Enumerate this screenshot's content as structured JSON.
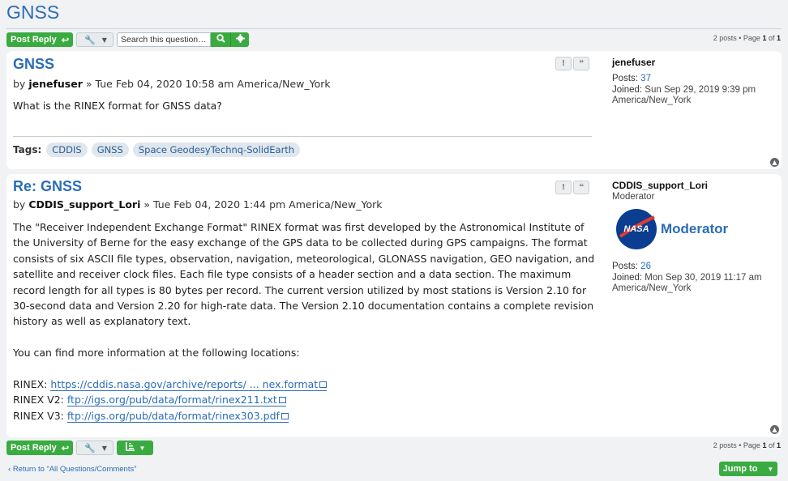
{
  "page": {
    "title": "GNSS"
  },
  "toolbar": {
    "post_reply": "Post Reply",
    "search_placeholder": "Search this question…",
    "page_info_prefix": "2 posts • Page ",
    "page_current": "1",
    "page_of": " of ",
    "page_total": "1"
  },
  "posts": [
    {
      "title": "GNSS",
      "by": "by",
      "author": "jenefuser",
      "date": "» Tue Feb 04, 2020 10:58 am America/New_York",
      "body": "What is the RINEX format for GNSS data?",
      "tags_label": "Tags:",
      "tags": [
        "CDDIS",
        "GNSS",
        "Space GeodesyTechnq-SolidEarth"
      ],
      "profile": {
        "name": "jenefuser",
        "posts_label": "Posts:",
        "posts": "37",
        "joined_label": "Joined:",
        "joined": "Sun Sep 29, 2019 9:39 pm",
        "tz": "America/New_York"
      }
    },
    {
      "title": "Re: GNSS",
      "by": "by",
      "author": "CDDIS_support_Lori",
      "date": "» Tue Feb 04, 2020 1:44 pm America/New_York",
      "paragraph1": [
        "The \"Receiver Independent Exchange Format\" RINEX format was first developed by the Astronomical Institute of",
        "the University of Berne for the easy exchange of the GPS data to be collected during GPS campaigns. The format",
        "consists of six ASCII file types, observation, navigation, meteorological, GLONASS navigation, GEO navigation, and",
        "satellite and receiver clock files. Each file type consists of a header section and a data section. The maximum",
        "record length for all types is 80 bytes per record. The current version utilized by most stations is Version 2.10 for",
        "30-second data and Version 2.20 for high-rate data. The Version 2.10 documentation contains a complete revision",
        "history as well as explanatory text."
      ],
      "paragraph2": "You can find more information at the following locations:",
      "links": [
        {
          "label": "RINEX:",
          "url": "https://cddis.nasa.gov/archive/reports/ ... nex.format"
        },
        {
          "label": "RINEX V2:",
          "url": "ftp://igs.org/pub/data/format/rinex211.txt"
        },
        {
          "label": "RINEX V3:",
          "url": "ftp://igs.org/pub/data/format/rinex303.pdf"
        }
      ],
      "profile": {
        "name": "CDDIS_support_Lori",
        "rank": "Moderator",
        "badge_nasa": "NASA",
        "badge_text": "Moderator",
        "posts_label": "Posts:",
        "posts": "26",
        "joined_label": "Joined:",
        "joined": "Mon Sep 30, 2019 11:17 am",
        "tz": "America/New_York"
      }
    }
  ],
  "footer": {
    "return_link": "Return to “All Questions/Comments”",
    "jump_to": "Jump to"
  },
  "colors": {
    "accent": "#2a6db5",
    "green": "#3aab40",
    "bg": "#f0f2f4"
  }
}
